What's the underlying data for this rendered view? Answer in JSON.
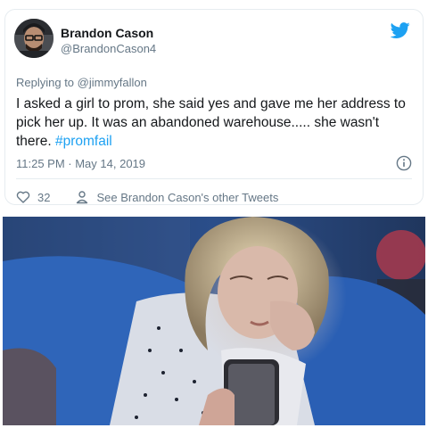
{
  "tweet": {
    "author_name": "Brandon Cason",
    "author_handle": "@BrandonCason4",
    "reply_prefix": "Replying to ",
    "reply_handle": "@jimmyfallon",
    "text": "I asked a girl to prom, she said yes and gave me her address to pick her up. It was an abandoned warehouse..... she wasn't there. ",
    "hashtag": "#promfail",
    "timestamp": "11:25 PM · May 14, 2019",
    "like_count": "32",
    "profile_link": "See Brandon Cason's other Tweets"
  },
  "icons": {
    "brand": "twitter-bird-icon",
    "info": "info-icon",
    "like": "heart-icon",
    "profile": "person-icon"
  },
  "colors": {
    "link": "#1da1f2",
    "muted": "#657786",
    "text": "#14171a",
    "border": "#e6ecf0"
  }
}
